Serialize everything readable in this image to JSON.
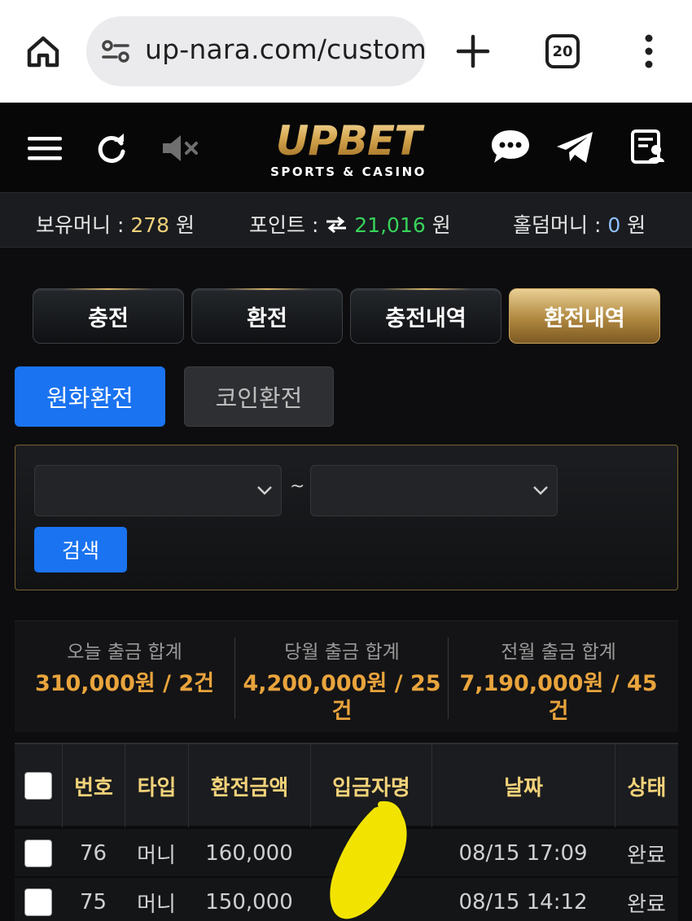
{
  "browser": {
    "url": "up-nara.com/custom",
    "tab_count": "20"
  },
  "header": {
    "logo_main": "UPBET",
    "logo_sub": "SPORTS & CASINO"
  },
  "balance": {
    "money_label": "보유머니 : ",
    "money_value": "278",
    "money_unit": " 원",
    "point_label": "포인트 : ",
    "point_value": "21,016",
    "point_unit": " 원",
    "holdem_label": "홀덤머니 : ",
    "holdem_value": "0",
    "holdem_unit": " 원"
  },
  "tabs": [
    {
      "label": "충전",
      "active": false
    },
    {
      "label": "환전",
      "active": false
    },
    {
      "label": "충전내역",
      "active": false
    },
    {
      "label": "환전내역",
      "active": true
    }
  ],
  "subtabs": {
    "won": "원화환전",
    "coin": "코인환전"
  },
  "filter": {
    "separator": "~",
    "search_label": "검색"
  },
  "stats": [
    {
      "label": "오늘 출금 합계",
      "value_line1": "310,000원 / 2건",
      "value_line2": ""
    },
    {
      "label": "당월 출금 합계",
      "value_line1": "4,200,000원 / 25",
      "value_line2": "건"
    },
    {
      "label": "전월 출금 합계",
      "value_line1": "7,190,000원 / 45",
      "value_line2": "건"
    }
  ],
  "table": {
    "headers": [
      "번호",
      "타입",
      "환전금액",
      "입금자명",
      "날짜",
      "상태"
    ],
    "rows": [
      {
        "no": "76",
        "type": "머니",
        "amount": "160,000",
        "name": "",
        "date": "08/15 17:09",
        "status": "완료"
      },
      {
        "no": "75",
        "type": "머니",
        "amount": "150,000",
        "name": "",
        "date": "08/15 14:12",
        "status": "완료"
      }
    ]
  }
}
